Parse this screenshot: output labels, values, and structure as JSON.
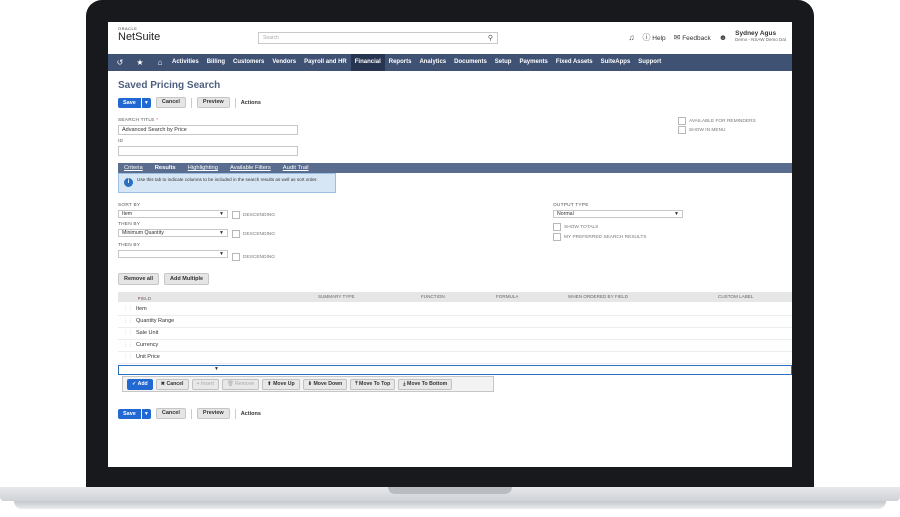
{
  "header": {
    "brand_top": "ORACLE",
    "brand_name": "NetSuite",
    "search_placeholder": "Search",
    "help": "Help",
    "feedback": "Feedback",
    "user_name": "Sydney Agus",
    "user_role": "Demo - NSAW Demo Dat"
  },
  "nav": {
    "items": [
      "Activities",
      "Billing",
      "Customers",
      "Vendors",
      "Payroll and HR",
      "Financial",
      "Reports",
      "Analytics",
      "Documents",
      "Setup",
      "Payments",
      "Fixed Assets",
      "SuiteApps",
      "Support"
    ],
    "active": "Financial"
  },
  "page": {
    "title": "Saved Pricing Search",
    "save": "Save",
    "cancel": "Cancel",
    "preview": "Preview",
    "actions": "Actions"
  },
  "form": {
    "search_title_label": "SEARCH TITLE",
    "search_title_required": "*",
    "search_title_value": "Advanced Search by Price",
    "id_label": "ID",
    "id_value": "",
    "available_for_reminders": "AVAILABLE FOR REMINDERS",
    "show_in_menu": "SHOW IN MENU"
  },
  "tabs": [
    "Criteria",
    "Results",
    "Highlighting",
    "Available Filters",
    "Audit Trail"
  ],
  "active_tab": "Results",
  "info": "Use this tab to indicate columns to be included in the search results as well as sort order.",
  "sort": {
    "sort_by_label": "SORT BY",
    "sort_by_value": "Item",
    "then_by_label": "THEN BY",
    "then_by_value": "Minimum Quantity",
    "then_by2_label": "THEN BY",
    "then_by2_value": "",
    "descending": "DESCENDING"
  },
  "output": {
    "output_type_label": "OUTPUT TYPE",
    "output_type_value": "Normal",
    "show_totals": "SHOW TOTALS",
    "my_preferred": "MY PREFERRED SEARCH RESULTS"
  },
  "list_buttons": {
    "remove_all": "Remove all",
    "add_multiple": "Add Multiple"
  },
  "grid": {
    "columns": [
      "FIELD",
      "SUMMARY TYPE",
      "FUNCTION",
      "FORMULA",
      "WHEN ORDERED BY FIELD",
      "CUSTOM LABEL"
    ],
    "field_required": "*",
    "rows": [
      "Item",
      "Quantity Range",
      "Sale Unit",
      "Currency",
      "Unit Price"
    ]
  },
  "edit_buttons": {
    "add": "✓ Add",
    "cancel": "✖ Cancel",
    "insert": "+ Insert",
    "remove": "🗑 Remove",
    "move_up": "⬆ Move Up",
    "move_down": "⬇ Move Down",
    "move_to_top": "⤒ Move To Top",
    "move_to_bottom": "⤓ Move To Bottom"
  },
  "colors": {
    "nav_bg": "#3f5274",
    "nav_active": "#273550",
    "primary": "#2268d2",
    "title": "#4d5f7f",
    "tabs_bg": "#5a6d8e"
  },
  "icons": [
    "history-icon",
    "star-icon",
    "home-icon",
    "search-icon",
    "notification-icon",
    "help-icon",
    "feedback-icon",
    "user-icon",
    "info-icon",
    "dropdown-arrow-icon"
  ]
}
